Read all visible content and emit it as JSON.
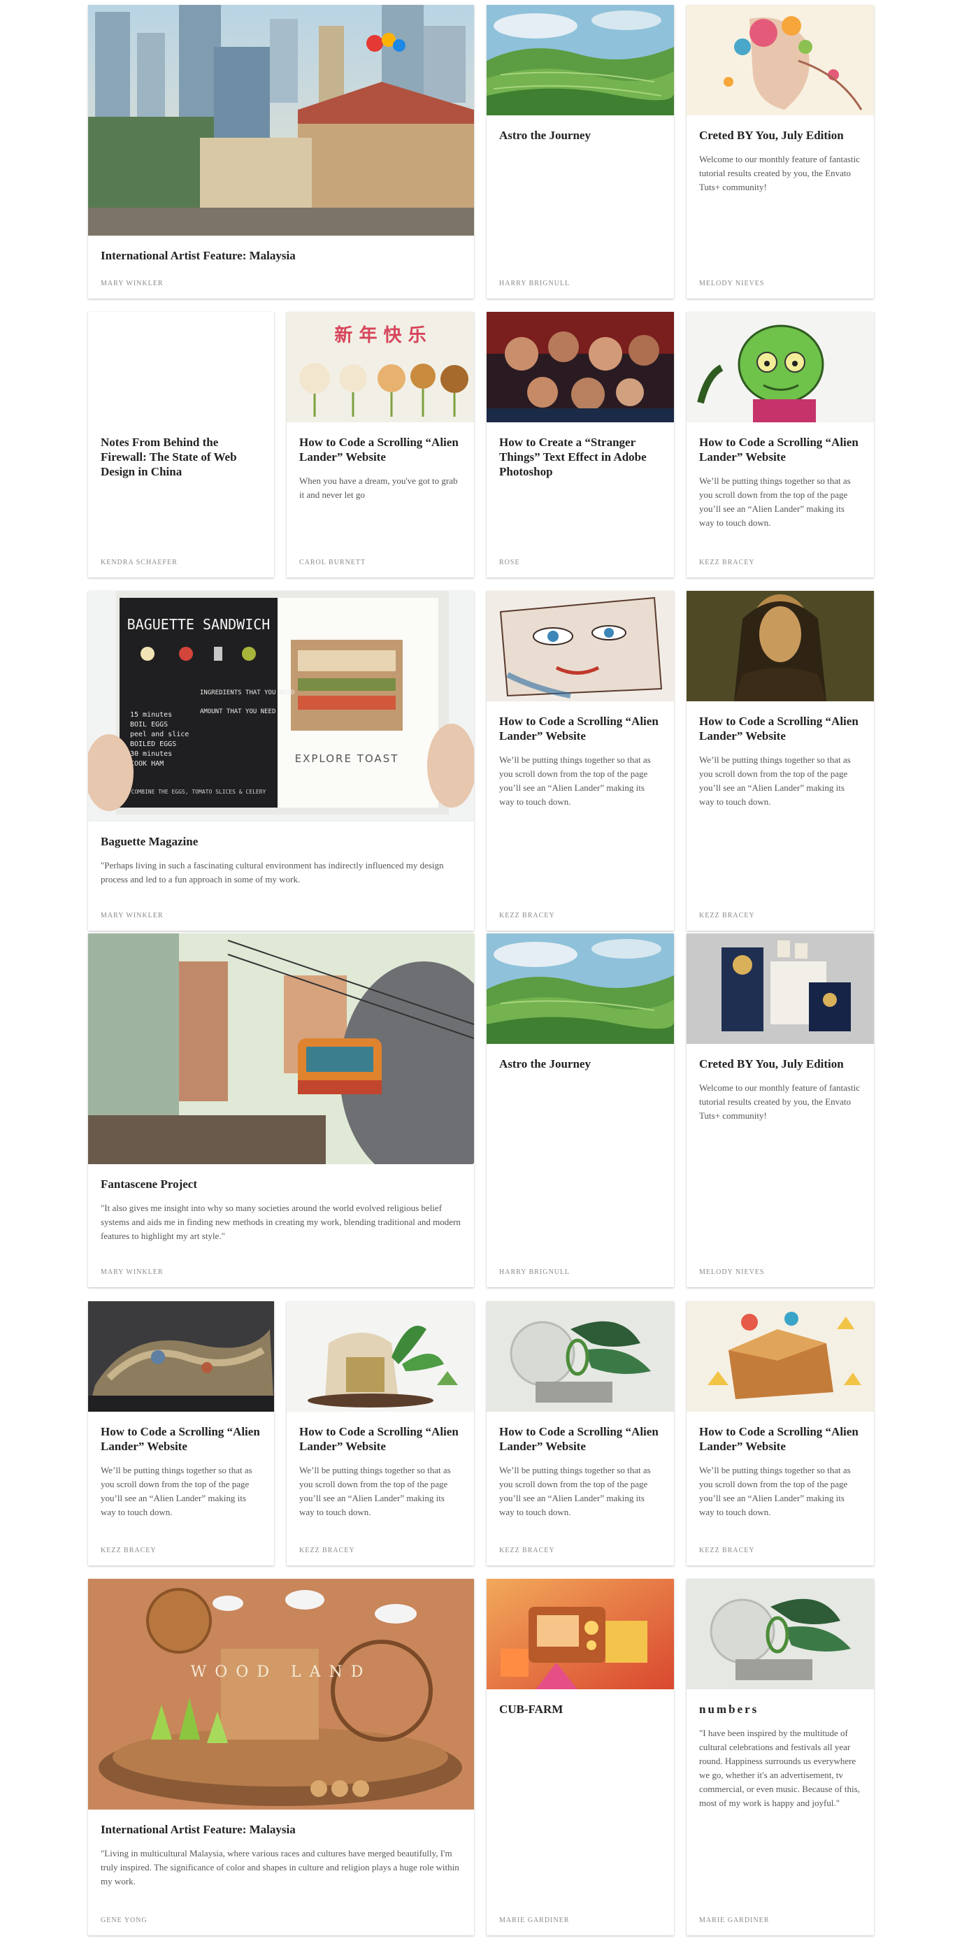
{
  "cards": [
    {
      "title": "International Artist Feature: Malaysia",
      "excerpt": "",
      "author": "MARY WINKLER",
      "image": "city-street-illustration"
    },
    {
      "title": "Astro the Journey",
      "excerpt": "",
      "author": "HARRY BRIGNULL",
      "image": "green-rice-terraces"
    },
    {
      "title": "Creted BY You, July Edition",
      "excerpt": "Welcome to our monthly feature of fantastic tutorial results created by you, the Envato Tuts+ community!",
      "author": "MELODY NIEVES",
      "image": "floral-portrait"
    },
    {
      "title": "Notes From Behind the Firewall: The State of Web Design in China",
      "excerpt": "",
      "author": "KENDRA SCHAEFER",
      "image": ""
    },
    {
      "title": "How to Code a Scrolling “Alien Lander” Website",
      "excerpt": "When you have a dream, you've got to grab it and never let go",
      "author": "CAROL BURNETT",
      "image": "cake-pops"
    },
    {
      "title": "How to Create a “Stranger Things” Text Effect in Adobe Photoshop",
      "excerpt": "",
      "author": "ROSE",
      "image": "movie-poster"
    },
    {
      "title": "How to Code a Scrolling “Alien Lander” Website",
      "excerpt": "We’ll be putting things together so that as you scroll down from the top of the page you’ll see an “Alien Lander” making its way to touch down.",
      "author": "KEZZ BRACEY",
      "image": "green-alien"
    },
    {
      "title": "Baguette Magazine",
      "excerpt": "\"Perhaps living in such a fascinating cultural environment has indirectly influenced my design process and led to a fun approach in some of my work.",
      "author": "MARY WINKLER",
      "image": "baguette-magazine-spread"
    },
    {
      "title": "How to Code a Scrolling “Alien Lander” Website",
      "excerpt": "We’ll be putting things together so that as you scroll down from the top of the page you’ll see an “Alien Lander” making its way to touch down.",
      "author": "KEZZ BRACEY",
      "image": "watercolor-face"
    },
    {
      "title": "How to Code a Scrolling “Alien Lander” Website",
      "excerpt": "We’ll be putting things together so that as you scroll down from the top of the page you’ll see an “Alien Lander” making its way to touch down.",
      "author": "KEZZ BRACEY",
      "image": "mona-lisa"
    },
    {
      "title": "Fantascene Project",
      "excerpt": "\"It also gives me insight into why so many societies around the world evolved religious belief systems and aids me in finding new methods in creating my work, blending traditional and modern features to highlight my art style.\"",
      "author": "MARY WINKLER",
      "image": "cable-car-town"
    },
    {
      "title": "Astro the Journey",
      "excerpt": "",
      "author": "HARRY BRIGNULL",
      "image": "green-rice-terraces"
    },
    {
      "title": "Creted BY You, July Edition",
      "excerpt": "Welcome to our monthly feature of fantastic tutorial results created by you, the Envato Tuts+ community!",
      "author": "MELODY NIEVES",
      "image": "stationery-set"
    },
    {
      "title": "How to Code a Scrolling “Alien Lander” Website",
      "excerpt": "We’ll be putting things together so that as you scroll down from the top of the page you’ll see an “Alien Lander” making its way to touch down.",
      "author": "KEZZ BRACEY",
      "image": "fabric-sculpture"
    },
    {
      "title": "How to Code a Scrolling “Alien Lander” Website",
      "excerpt": "We’ll be putting things together so that as you scroll down from the top of the page you’ll see an “Alien Lander” making its way to touch down.",
      "author": "KEZZ BRACEY",
      "image": "seed-pouch-plants"
    },
    {
      "title": "How to Code a Scrolling “Alien Lander” Website",
      "excerpt": "We’ll be putting things together so that as you scroll down from the top of the page you’ll see an “Alien Lander” making its way to touch down.",
      "author": "KEZZ BRACEY",
      "image": "mirror-plant-still-life"
    },
    {
      "title": "How to Code a Scrolling “Alien Lander” Website",
      "excerpt": "We’ll be putting things together so that as you scroll down from the top of the page you’ll see an “Alien Lander” making its way to touch down.",
      "author": "KEZZ BRACEY",
      "image": "treasure-chest-illustration"
    },
    {
      "title": "International Artist Feature: Malaysia",
      "excerpt": "\"Living in multicultural Malaysia, where various races and cultures have merged beautifully, I'm truly inspired. The significance of color and shapes in culture and religion plays a huge role within my work.",
      "author": "GENE YONG",
      "image": "wood-land-diorama",
      "image_text": "WOOD LAND"
    },
    {
      "title": "CUB-FARM",
      "excerpt": "",
      "author": "MARIE GARDINER",
      "image": "retro-tv-machine"
    },
    {
      "title": "numbers",
      "excerpt": "\"I have been inspired by the multitude of cultural celebrations and festivals all year round. Happiness surrounds us everywhere we go, whether it's an advertisement, tv commercial, or even music. Because of this, most of my work is happy and joyful.\"",
      "author": "MARIE GARDINER",
      "image": "mirror-plant-still-life"
    }
  ],
  "magazine_art": {
    "headline": "BAGUETTE SANDWICH",
    "ingredients": "INGREDIENTS THAT YOU NEED",
    "amount": "AMOUNT THAT YOU NEED",
    "footer": "COMBINE THE EGGS, TOMATO SLICES & CELERY",
    "right_caption": "EXPLORE TOAST",
    "steps": [
      "15 minutes",
      "BOIL EGGS",
      "peel and slice",
      "BOILED EGGS",
      "30 minutes",
      "COOK HAM"
    ]
  },
  "cake_pop_sign": "新 年 快 乐"
}
